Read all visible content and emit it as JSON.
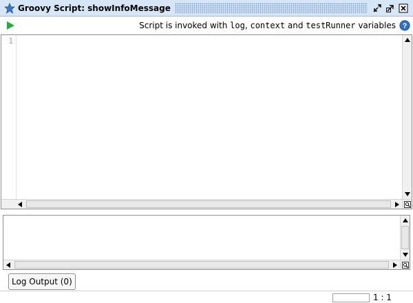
{
  "window": {
    "title": "Groovy Script: showInfoMessage"
  },
  "toolbar": {
    "info_prefix": "Script is invoked with ",
    "var_log": "log",
    "sep_comma": ", ",
    "var_context": "context",
    "sep_and": " and ",
    "var_testrunner": "testRunner",
    "info_suffix": " variables"
  },
  "editor": {
    "line_numbers": [
      "1"
    ]
  },
  "log_tab": {
    "label": "Log Output (0)"
  },
  "status": {
    "cursor_position": "1 : 1"
  },
  "colors": {
    "titlebar_bg": "#d7e6f7",
    "run_green": "#2aa84a",
    "help_blue": "#2f6fc1",
    "star_blue": "#3a78c9"
  }
}
